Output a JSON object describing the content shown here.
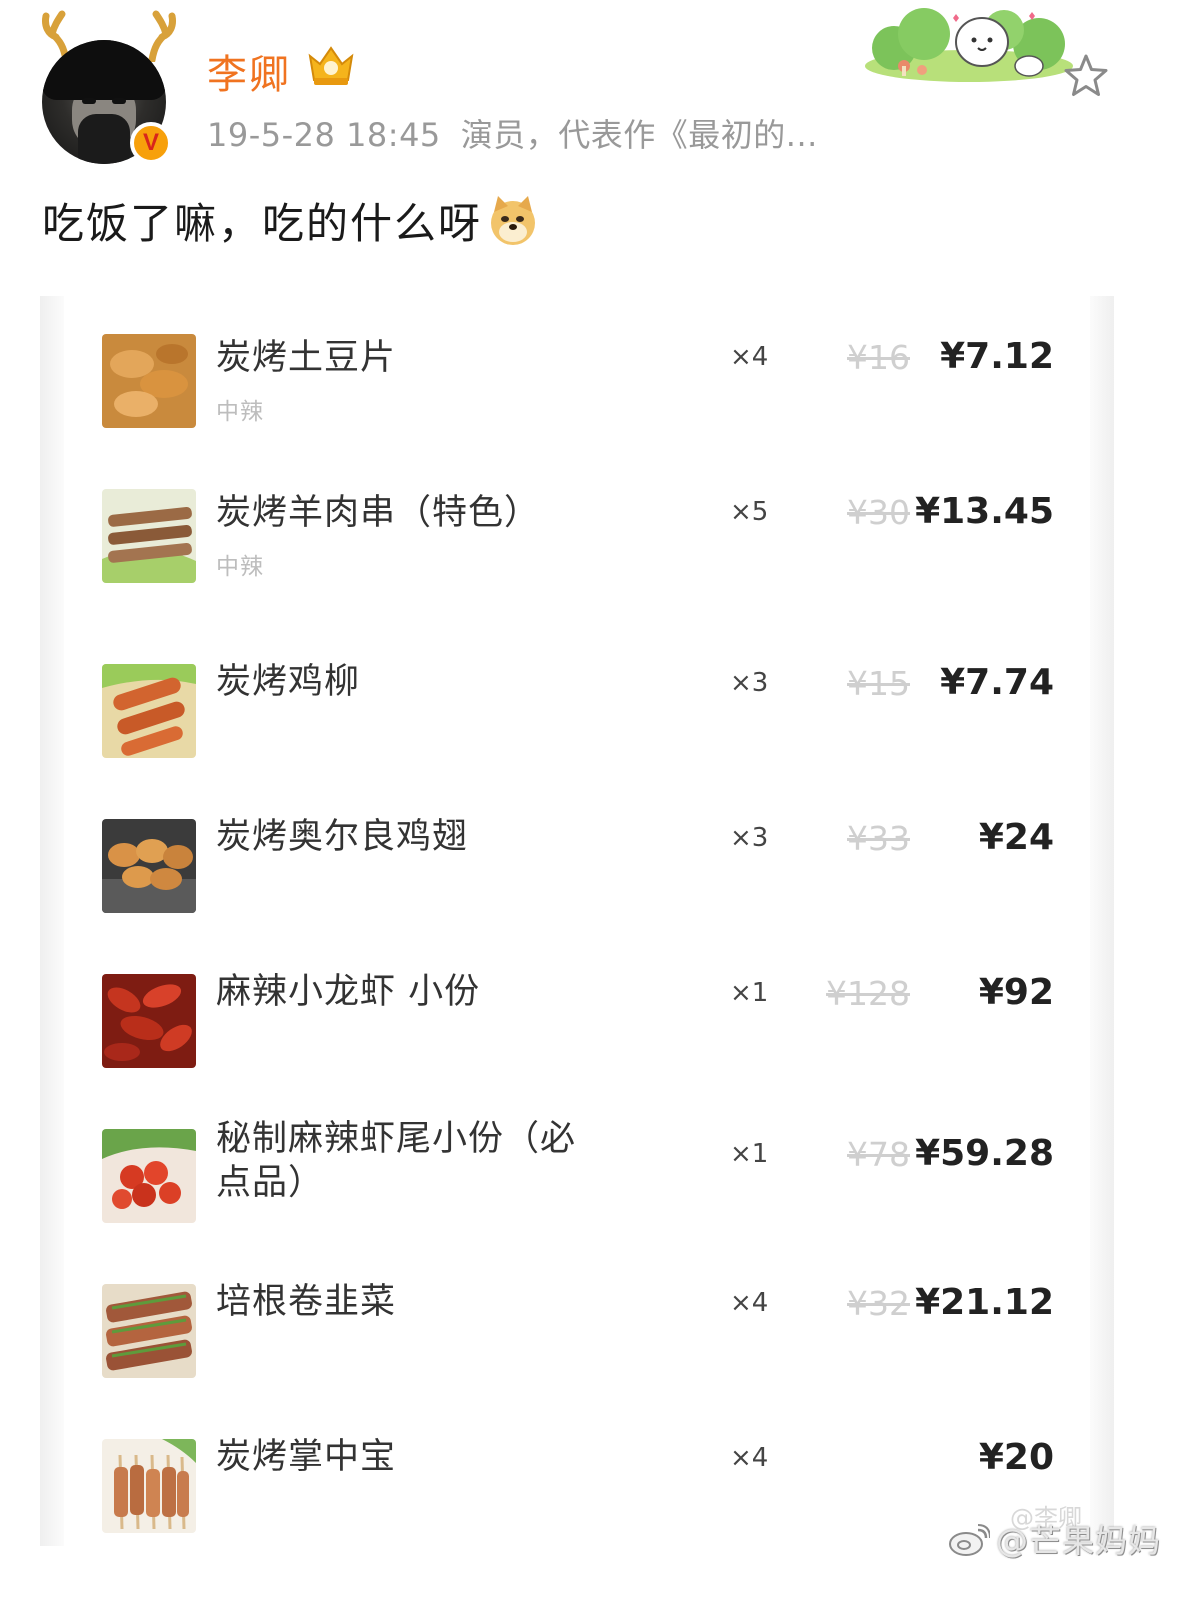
{
  "post": {
    "username": "李卿",
    "timestamp": "19-5-28 18:45",
    "bio": "演员，代表作《最初的...",
    "text": "吃饭了嘛，吃的什么呀",
    "icons": [
      "antler-icon",
      "verified-icon",
      "vip-crown-icon",
      "doge-emoji-icon",
      "star-icon"
    ]
  },
  "order": {
    "items": [
      {
        "name": "炭烤土豆片",
        "spice": "中辣",
        "qty": "×4",
        "original": "¥16",
        "price": "¥7.12"
      },
      {
        "name": "炭烤羊肉串（特色）",
        "spice": "中辣",
        "qty": "×5",
        "original": "¥30",
        "price": "¥13.45"
      },
      {
        "name": "炭烤鸡柳",
        "spice": "",
        "qty": "×3",
        "original": "¥15",
        "price": "¥7.74"
      },
      {
        "name": "炭烤奥尔良鸡翅",
        "spice": "",
        "qty": "×3",
        "original": "¥33",
        "price": "¥24"
      },
      {
        "name": "麻辣小龙虾 小份",
        "spice": "",
        "qty": "×1",
        "original": "¥128",
        "price": "¥92"
      },
      {
        "name": "秘制麻辣虾尾小份（必点品）",
        "spice": "",
        "qty": "×1",
        "original": "¥78",
        "price": "¥59.28"
      },
      {
        "name": "培根卷韭菜",
        "spice": "",
        "qty": "×4",
        "original": "¥32",
        "price": "¥21.12"
      },
      {
        "name": "炭烤掌中宝",
        "spice": "",
        "qty": "×4",
        "original": "",
        "price": "¥20"
      }
    ]
  },
  "watermark": {
    "text": "@芒果妈妈",
    "ghost": "@李卿"
  },
  "colors": {
    "username": "#f07320",
    "meta": "#999999",
    "verified": "#f7a00b",
    "strike": "#cfcfcf"
  }
}
